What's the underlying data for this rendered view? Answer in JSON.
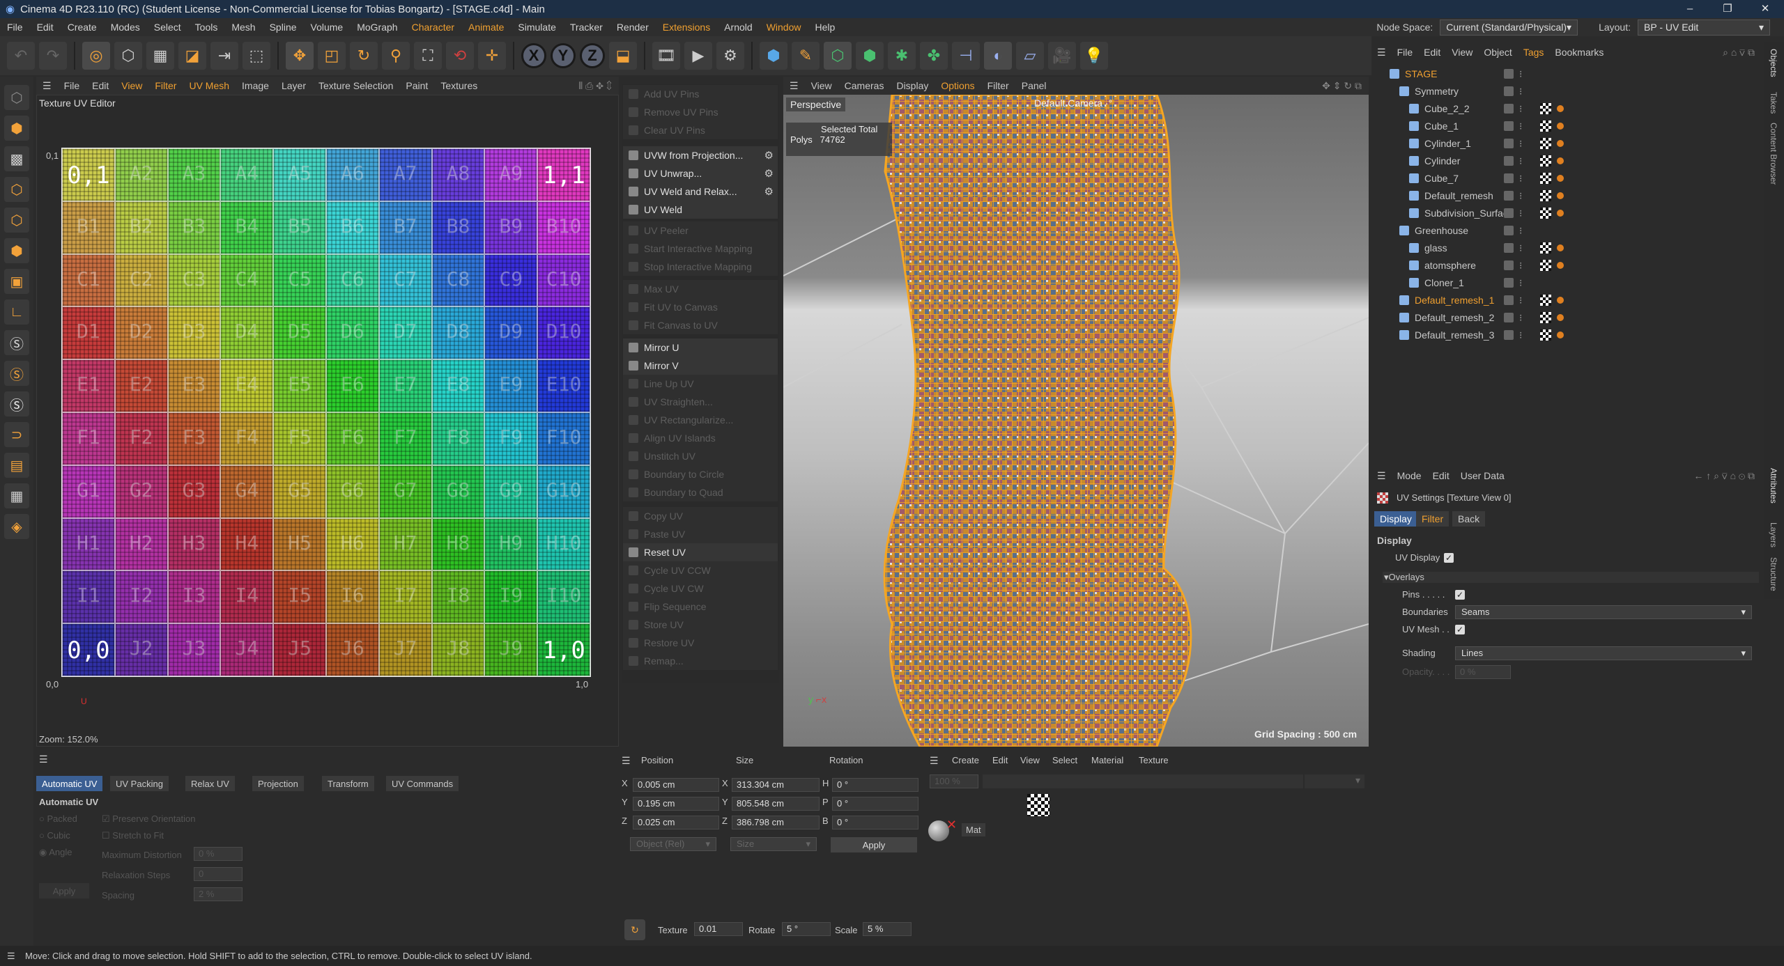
{
  "window": {
    "title": "Cinema 4D R23.110 (RC) (Student License - Non-Commercial License for Tobias Bongartz) - [STAGE.c4d] - Main",
    "controls": [
      "–",
      "❐",
      "✕"
    ]
  },
  "menu": {
    "items": [
      "File",
      "Edit",
      "Create",
      "Modes",
      "Select",
      "Tools",
      "Mesh",
      "Spline",
      "Volume",
      "MoGraph",
      "Character",
      "Animate",
      "Simulate",
      "Tracker",
      "Render",
      "Extensions",
      "Arnold",
      "Window",
      "Help"
    ],
    "node_space_label": "Node Space:",
    "node_space_value": "Current (Standard/Physical)",
    "layout_label": "Layout:",
    "layout_value": "BP - UV Edit"
  },
  "uv_editor": {
    "menu": [
      "File",
      "Edit",
      "View",
      "Filter",
      "UV Mesh",
      "Image",
      "Layer",
      "Texture Selection",
      "Paint",
      "Textures"
    ],
    "title": "Texture UV Editor",
    "rows": [
      "A",
      "B",
      "C",
      "D",
      "E",
      "F",
      "G",
      "H",
      "I",
      "J"
    ],
    "corner_00": "0,0",
    "corner_01": "0,1",
    "corner_10": "1,0",
    "axis_u": "U",
    "zoom": "Zoom: 152.0%"
  },
  "uv_commands": [
    {
      "label": "Add UV Pins",
      "enabled": false
    },
    {
      "label": "Remove UV Pins",
      "enabled": false
    },
    {
      "label": "Clear UV Pins",
      "enabled": false
    },
    {
      "label": "UVW from Projection...",
      "enabled": true,
      "gear": true
    },
    {
      "label": "UV Unwrap...",
      "enabled": true,
      "gear": true
    },
    {
      "label": "UV Weld and Relax...",
      "enabled": true,
      "gear": true
    },
    {
      "label": "UV Weld",
      "enabled": true
    },
    {
      "label": "UV Peeler",
      "enabled": false
    },
    {
      "label": "Start Interactive Mapping",
      "enabled": false
    },
    {
      "label": "Stop Interactive Mapping",
      "enabled": false
    },
    {
      "label": "Max UV",
      "enabled": false
    },
    {
      "label": "Fit UV to Canvas",
      "enabled": false
    },
    {
      "label": "Fit Canvas to UV",
      "enabled": false
    },
    {
      "label": "Mirror U",
      "enabled": true
    },
    {
      "label": "Mirror V",
      "enabled": true
    },
    {
      "label": "Line Up UV",
      "enabled": false
    },
    {
      "label": "UV Straighten...",
      "enabled": false
    },
    {
      "label": "UV Rectangularize...",
      "enabled": false
    },
    {
      "label": "Align UV Islands",
      "enabled": false
    },
    {
      "label": "Unstitch UV",
      "enabled": false
    },
    {
      "label": "Boundary to Circle",
      "enabled": false
    },
    {
      "label": "Boundary to Quad",
      "enabled": false
    },
    {
      "label": "Copy UV",
      "enabled": false
    },
    {
      "label": "Paste UV",
      "enabled": false
    },
    {
      "label": "Reset UV",
      "enabled": true
    },
    {
      "label": "Cycle UV CCW",
      "enabled": false
    },
    {
      "label": "Cycle UV CW",
      "enabled": false
    },
    {
      "label": "Flip Sequence",
      "enabled": false
    },
    {
      "label": "Store UV",
      "enabled": false
    },
    {
      "label": "Restore UV",
      "enabled": false
    },
    {
      "label": "Remap...",
      "enabled": false
    }
  ],
  "viewport": {
    "menu": [
      "View",
      "Cameras",
      "Display",
      "Options",
      "Filter",
      "Panel"
    ],
    "label": "Perspective",
    "camera": "Default Camera ·°",
    "selected_total": "Selected Total",
    "polys_label": "Polys",
    "polys_value": "74762",
    "grid_spacing": "Grid Spacing : 500 cm",
    "mesh_color": "#f5a623"
  },
  "objects": {
    "menu": [
      "File",
      "Edit",
      "View",
      "Object",
      "Tags",
      "Bookmarks"
    ],
    "items": [
      {
        "name": "STAGE",
        "level": 0,
        "hl": true
      },
      {
        "name": "Symmetry",
        "level": 1
      },
      {
        "name": "Cube_2_2",
        "level": 2
      },
      {
        "name": "Cube_1",
        "level": 2
      },
      {
        "name": "Cylinder_1",
        "level": 2
      },
      {
        "name": "Cylinder",
        "level": 2
      },
      {
        "name": "Cube_7",
        "level": 2
      },
      {
        "name": "Default_remesh",
        "level": 2
      },
      {
        "name": "Subdivision_Surface",
        "level": 2
      },
      {
        "name": "Greenhouse",
        "level": 1
      },
      {
        "name": "glass",
        "level": 2
      },
      {
        "name": "atomsphere",
        "level": 2
      },
      {
        "name": "Cloner_1",
        "level": 2
      },
      {
        "name": "Default_remesh_1",
        "level": 1,
        "hl": true
      },
      {
        "name": "Default_remesh_2",
        "level": 1
      },
      {
        "name": "Default_remesh_3",
        "level": 1
      }
    ]
  },
  "side_tabs": [
    "Objects",
    "Takes",
    "Content Browser",
    "Attributes",
    "Layers",
    "Structure"
  ],
  "attributes": {
    "menu": [
      "Mode",
      "Edit",
      "User Data"
    ],
    "header": "UV Settings [Texture View 0]",
    "tabs": [
      "Display",
      "Filter",
      "Back"
    ],
    "section": "Display",
    "uv_display": "UV Display",
    "overlays": "Overlays",
    "pins": "Pins . . . . .",
    "boundaries": "Boundaries",
    "boundaries_value": "Seams",
    "uv_mesh": "UV Mesh . .",
    "shading": "Shading",
    "shading_value": "Lines",
    "opacity": "Opacity. . . .",
    "opacity_value": "0 %"
  },
  "auto_uv": {
    "tabs": [
      "Automatic UV",
      "UV Packing",
      "Relax UV",
      "Projection",
      "Transform",
      "UV Commands"
    ],
    "title": "Automatic UV",
    "packed": "Packed",
    "cubic": "Cubic",
    "angle": "Angle",
    "preserve": "Preserve Orientation",
    "stretch": "Stretch to Fit",
    "max_dist": "Maximum Distortion",
    "max_dist_val": "0 %",
    "relax": "Relaxation Steps",
    "relax_val": "0",
    "spacing": "Spacing",
    "spacing_val": "2 %",
    "apply": "Apply"
  },
  "coords": {
    "headers": [
      "Position",
      "Size",
      "Rotation"
    ],
    "rows": [
      {
        "axis": "X",
        "pos": "0.005 cm",
        "saxis": "X",
        "size": "313.304 cm",
        "raxis": "H",
        "rot": "0 °"
      },
      {
        "axis": "Y",
        "pos": "0.195 cm",
        "saxis": "Y",
        "size": "805.548 cm",
        "raxis": "P",
        "rot": "0 °"
      },
      {
        "axis": "Z",
        "pos": "0.025 cm",
        "saxis": "Z",
        "size": "386.798 cm",
        "raxis": "B",
        "rot": "0 °"
      }
    ],
    "mode": "Object (Rel)",
    "size_mode": "Size",
    "apply": "Apply",
    "texture_label": "Texture",
    "texture_val": "0.01",
    "rotate_label": "Rotate",
    "rotate_val": "5 °",
    "scale_label": "Scale",
    "scale_val": "5 %"
  },
  "materials": {
    "menu": [
      "Create",
      "Edit",
      "View",
      "Select",
      "Material",
      "Texture"
    ],
    "zoom": "100 %",
    "mat_name": "Mat"
  },
  "status": "Move: Click and drag to move selection. Hold SHIFT to add to the selection, CTRL to remove. Double-click to select UV island."
}
